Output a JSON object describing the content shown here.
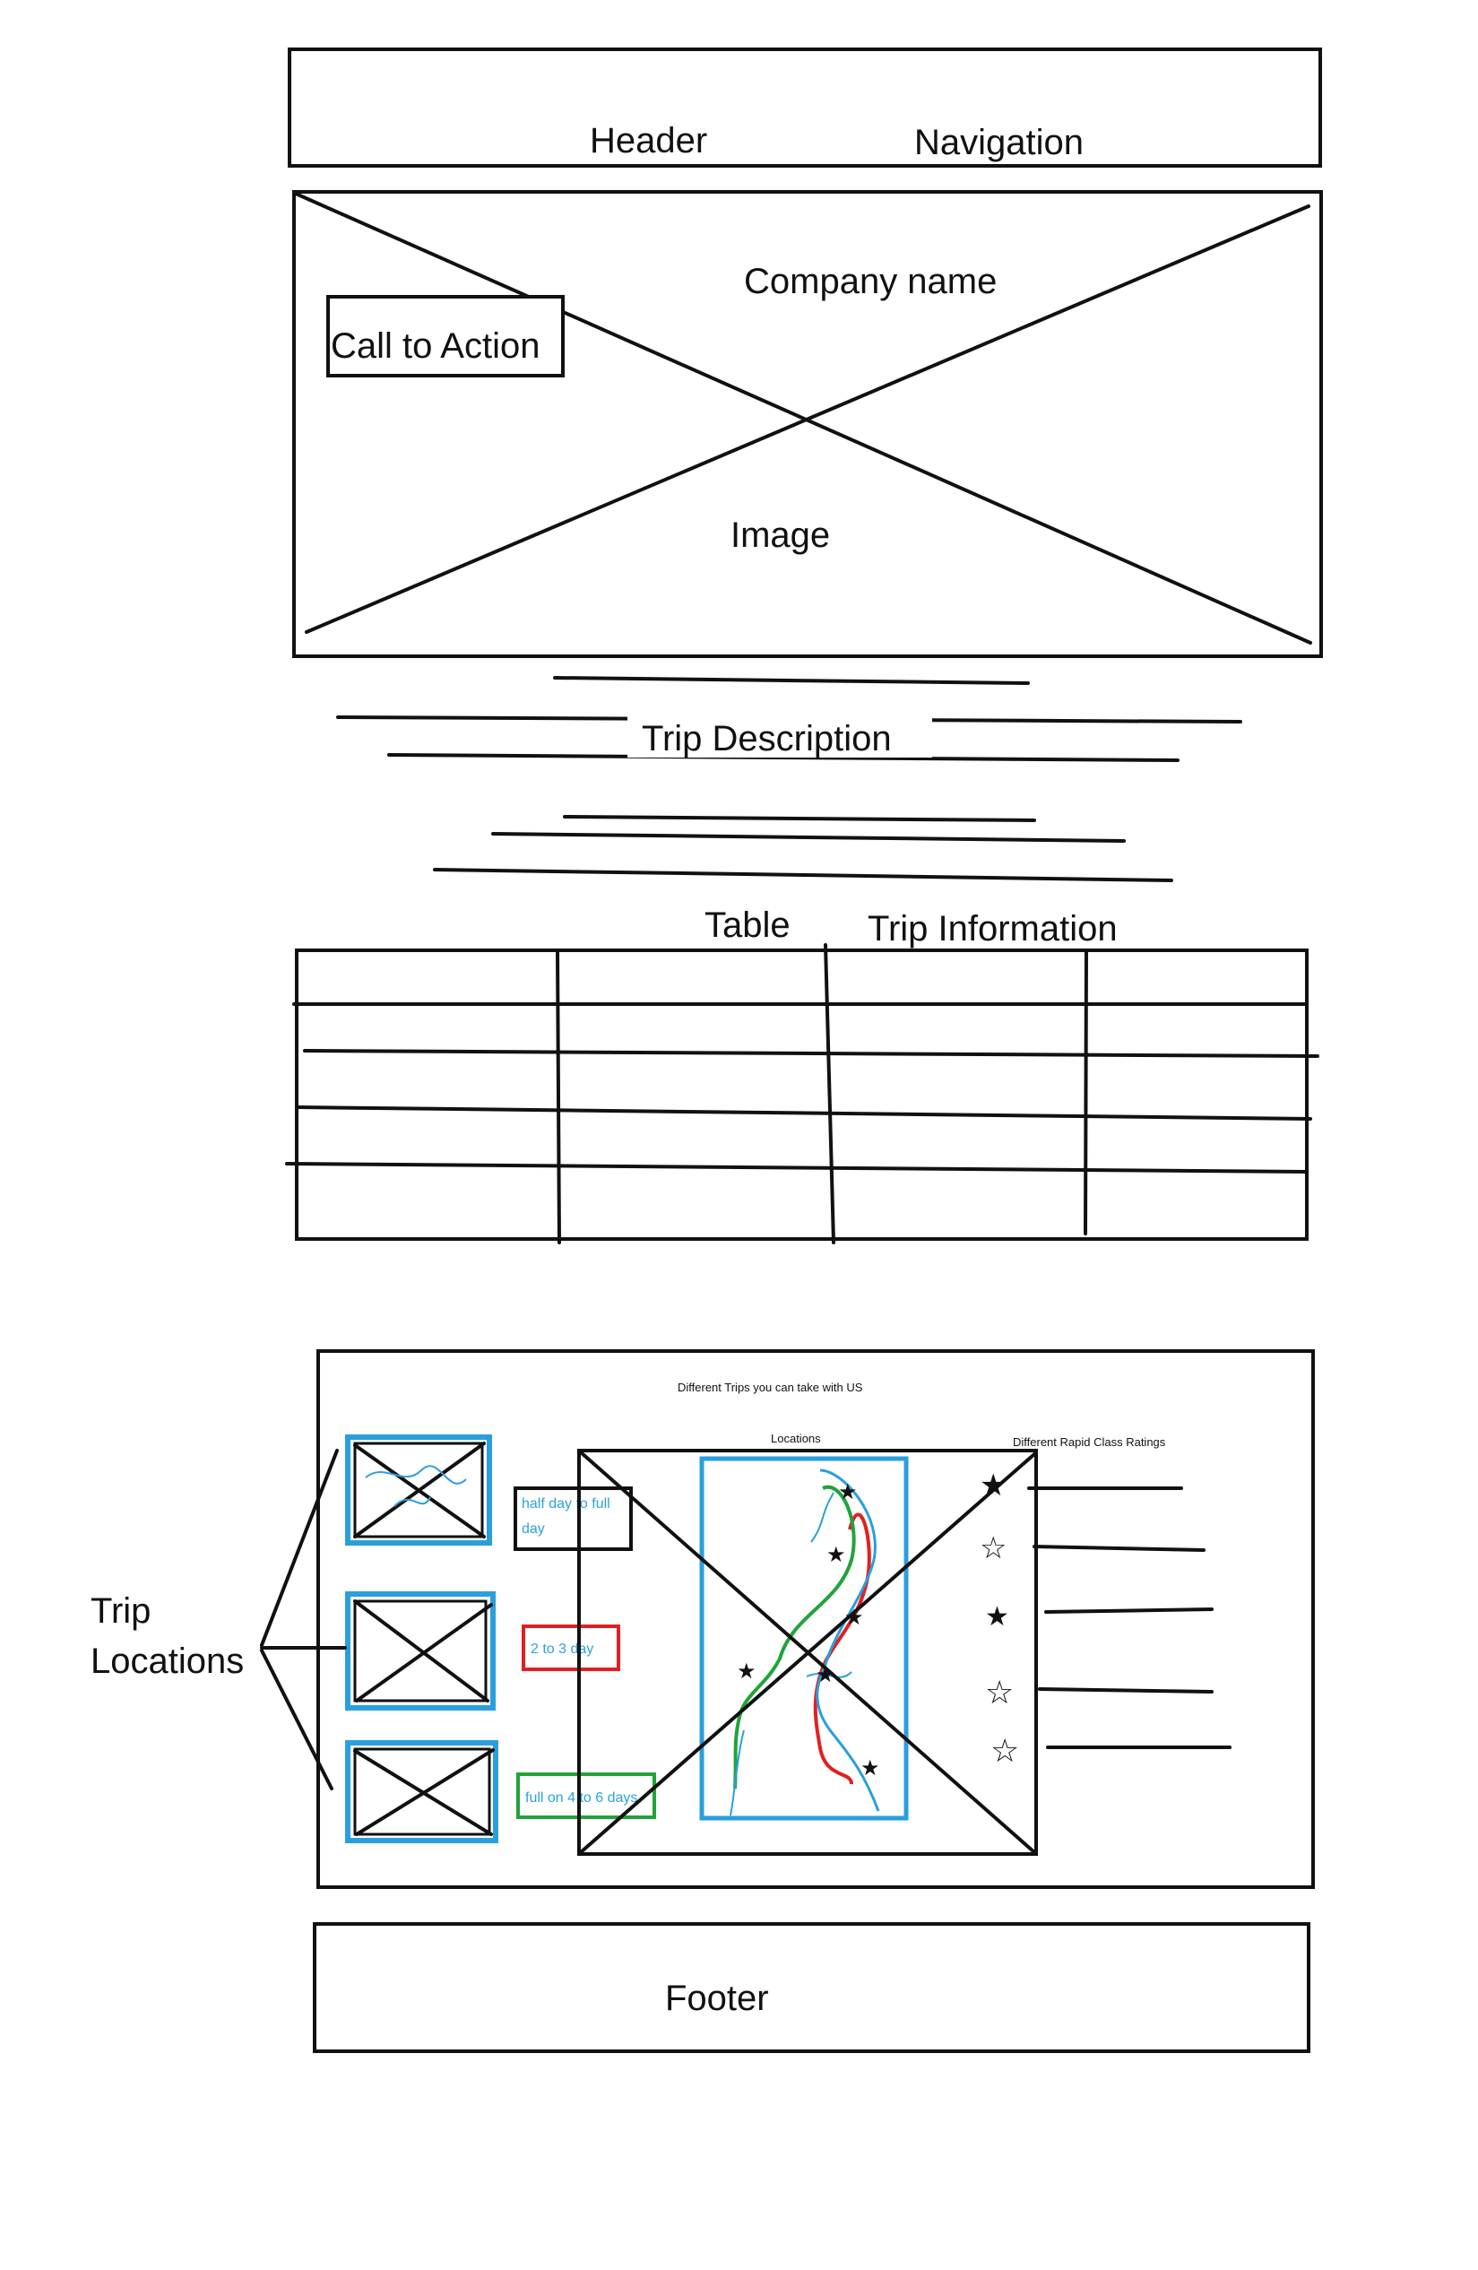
{
  "header": {
    "label": "Header",
    "nav_label": "Navigation"
  },
  "hero": {
    "company_name": "Company name",
    "cta_label": "Call to Action",
    "image_label": "Image"
  },
  "description": {
    "label": "Trip Description"
  },
  "table": {
    "label": "Table",
    "title": "Trip Information"
  },
  "trips": {
    "title": "Different Trips you can take with US",
    "locations_label": "Locations",
    "ratings_label": "Different Rapid Class Ratings",
    "side_label_line1": "Trip",
    "side_label_line2": "Locations",
    "durations": [
      {
        "label_line1": "half day to full",
        "label_line2": "day",
        "border": "#111111",
        "text": "#2aa3dd"
      },
      {
        "label_line1": "2 to 3 day",
        "label_line2": "",
        "border": "#e02020",
        "text": "#2aa3dd"
      },
      {
        "label_line1": "full on 4 to 6 days",
        "label_line2": "",
        "border": "#22a33a",
        "text": "#2aa3dd"
      }
    ],
    "accent": "#2a9fdc",
    "river_colors": [
      "#e02020",
      "#22a33a",
      "#2a9fdc"
    ]
  },
  "footer": {
    "label": "Footer"
  }
}
